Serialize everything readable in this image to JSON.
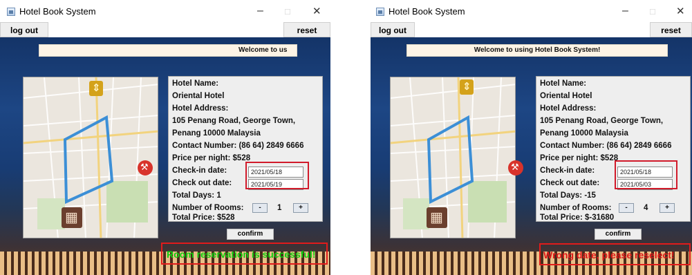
{
  "left_window": {
    "title": "Hotel Book System",
    "logout_label": "log out",
    "reset_label": "reset",
    "welcome_text": "Welcome to us",
    "hotel": {
      "name_label": "Hotel Name:",
      "name": "Oriental Hotel",
      "address_label": "Hotel Address:",
      "address_line1": "105 Penang Road, George Town,",
      "address_line2": "Penang 10000 Malaysia",
      "contact": "Contact Number: (86 64) 2849 6666",
      "price": "Price per night: $528"
    },
    "checkin_label": "Check-in date:",
    "checkin_value": "2021/05/18",
    "checkout_label": "Check out date:",
    "checkout_value": "2021/05/19",
    "total_days": "Total Days: 1",
    "rooms_label": "Number of Rooms:",
    "rooms_value": "1",
    "minus_label": "-",
    "plus_label": "+",
    "total_price": "Total Price: $528",
    "confirm_label": "confirm",
    "status_text": "Room reservation is successful!"
  },
  "right_window": {
    "title": "Hotel Book System",
    "logout_label": "log out",
    "reset_label": "reset",
    "welcome_text": "Welcome to using Hotel Book System!",
    "hotel": {
      "name_label": "Hotel Name:",
      "name": "Oriental Hotel",
      "address_label": "Hotel Address:",
      "address_line1": "105 Penang Road, George Town,",
      "address_line2": "Penang 10000 Malaysia",
      "contact": "Contact Number: (86 64) 2849 6666",
      "price": "Price per night: $528"
    },
    "checkin_label": "Check-in date:",
    "checkin_value": "2021/05/18",
    "checkout_label": "Check out date:",
    "checkout_value": "2021/05/03",
    "total_days": "Total Days: -15",
    "rooms_label": "Number of Rooms:",
    "rooms_value": "4",
    "minus_label": "-",
    "plus_label": "+",
    "total_price": "Total Price: $-31680",
    "confirm_label": "confirm",
    "status_text": "Wrong date, please reselect!"
  },
  "window_controls": {
    "minimize": "–",
    "maximize": "□",
    "close": "✕"
  },
  "colors": {
    "success_text": "#10d010",
    "error_text": "#e01818",
    "highlight_box": "#d11a2a",
    "route_line": "#3c8fd6"
  }
}
